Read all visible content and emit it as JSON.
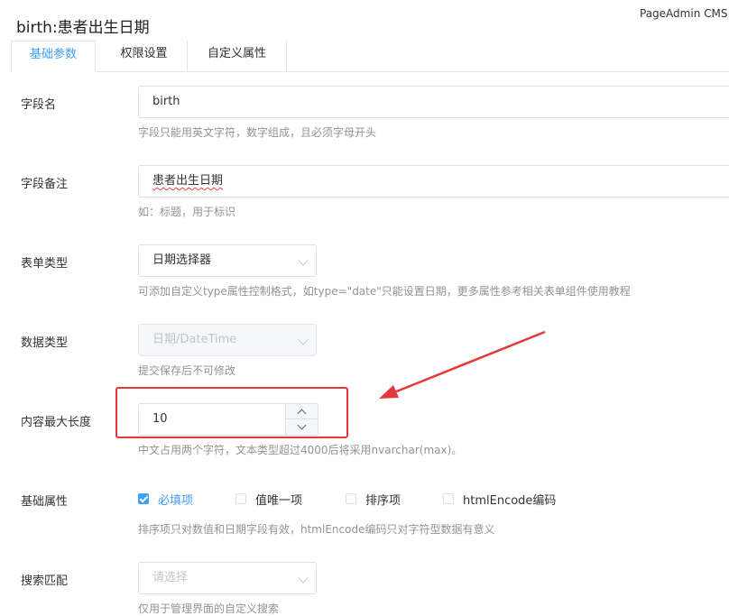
{
  "header": {
    "title": "birth:患者出生日期",
    "brand": "PageAdmin CMS"
  },
  "tabs": [
    {
      "label": "基础参数",
      "active": true
    },
    {
      "label": "权限设置",
      "active": false
    },
    {
      "label": "自定义属性",
      "active": false
    }
  ],
  "form": {
    "field_name": {
      "label": "字段名",
      "value": "birth",
      "hint": "字段只能用英文字符，数字组成，且必须字母开头"
    },
    "field_note": {
      "label": "字段备注",
      "value": "患者出生日期",
      "hint": "如：标题，用于标识"
    },
    "form_type": {
      "label": "表单类型",
      "value": "日期选择器",
      "hint": "可添加自定义type属性控制格式，如type=\"date\"只能设置日期，更多属性参考相关表单组件使用教程"
    },
    "data_type": {
      "label": "数据类型",
      "value": "日期/DateTime",
      "disabled": true,
      "hint": "提交保存后不可修改"
    },
    "max_length": {
      "label": "内容最大长度",
      "value": "10",
      "hint": "中文占用两个字符，文本类型超过4000后将采用nvarchar(max)。"
    },
    "base_attrs": {
      "label": "基础属性",
      "options": [
        {
          "label": "必填项",
          "checked": true
        },
        {
          "label": "值唯一项",
          "checked": false
        },
        {
          "label": "排序项",
          "checked": false
        },
        {
          "label": "htmlEncode编码",
          "checked": false
        }
      ],
      "hint": "排序项只对数值和日期字段有效，htmlEncode编码只对字符型数据有意义"
    },
    "search_match": {
      "label": "搜索匹配",
      "placeholder": "请选择",
      "hint": "仅用于管理界面的自定义搜索"
    }
  },
  "annotation": {
    "highlight_color": "#e4393c",
    "arrow_color": "#e4393c"
  },
  "colors": {
    "accent": "#409eff",
    "hint": "#909399",
    "border": "#dcdfe6"
  }
}
